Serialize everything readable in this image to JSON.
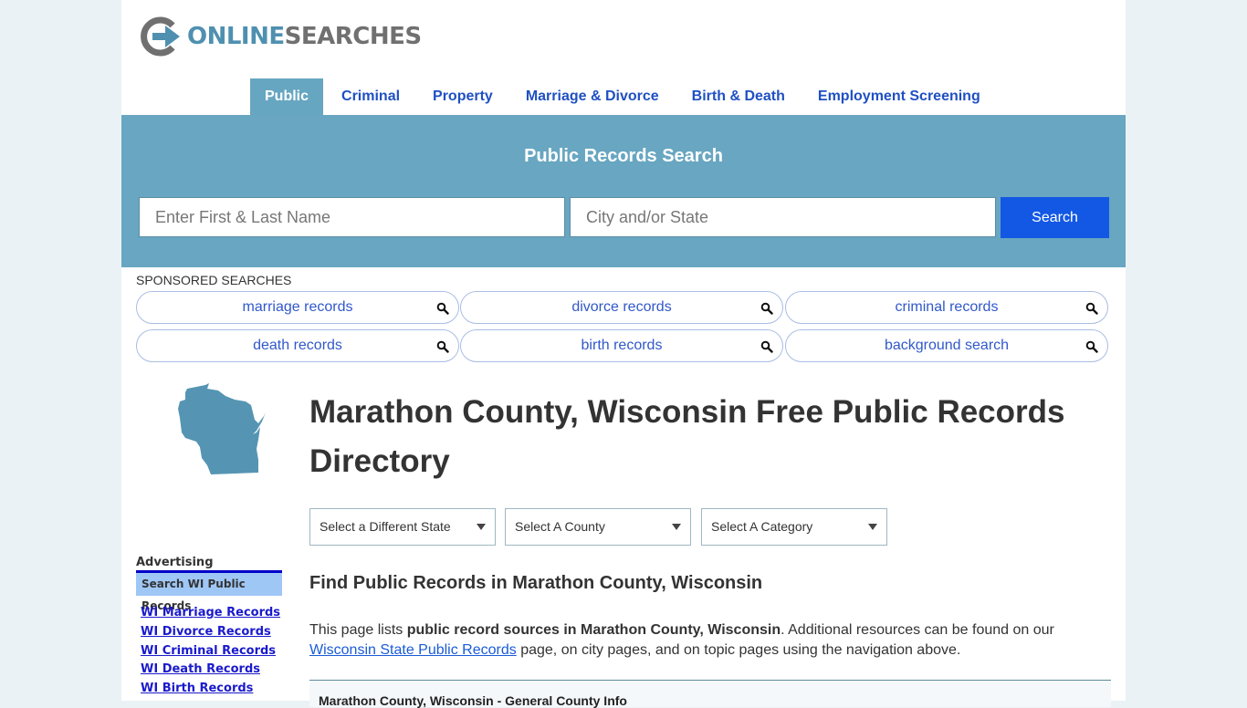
{
  "brand": {
    "part1": "ONLINE",
    "part2": "SEARCHES",
    "accent_color": "#4f90b0",
    "gray_color": "#707070"
  },
  "nav": {
    "items": [
      {
        "label": "Public",
        "active": true
      },
      {
        "label": "Criminal",
        "active": false
      },
      {
        "label": "Property",
        "active": false
      },
      {
        "label": "Marriage & Divorce",
        "active": false
      },
      {
        "label": "Birth & Death",
        "active": false
      },
      {
        "label": "Employment Screening",
        "active": false
      }
    ]
  },
  "hero": {
    "title": "Public Records Search",
    "name_placeholder": "Enter First & Last Name",
    "city_placeholder": "City and/or State",
    "search_label": "Search",
    "bg_color": "#68a6c1",
    "button_color": "#1358e4"
  },
  "sponsored": {
    "label": "SPONSORED SEARCHES",
    "items": [
      {
        "label": "marriage records",
        "icon": "search-icon"
      },
      {
        "label": "divorce records",
        "icon": "search-icon"
      },
      {
        "label": "criminal records",
        "icon": "search-icon"
      },
      {
        "label": "death records",
        "icon": "search-icon"
      },
      {
        "label": "birth records",
        "icon": "search-icon"
      },
      {
        "label": "background search",
        "icon": "search-icon"
      }
    ]
  },
  "main": {
    "title": "Marathon County, Wisconsin Free Public Records Directory",
    "selects": [
      {
        "selected": "Select a Different State"
      },
      {
        "selected": "Select A County"
      },
      {
        "selected": "Select A Category"
      }
    ],
    "section_heading": "Find Public Records in Marathon County, Wisconsin",
    "intro": {
      "pre": "This page lists ",
      "bold": "public record sources in Marathon County, Wisconsin",
      "mid": ". Additional resources can be found on our ",
      "link": "Wisconsin State Public Records",
      "post": " page, on city pages, and on topic pages using the navigation above."
    },
    "info_box_title": "Marathon County, Wisconsin - General County Info"
  },
  "sidebar": {
    "state_icon": "wisconsin-map-icon",
    "advertising_label": "Advertising",
    "ad_heading": "Search WI Public Records",
    "ad_links": [
      "WI Marriage Records",
      "WI Divorce Records",
      "WI Criminal Records",
      "WI Death Records",
      "WI Birth Records"
    ]
  }
}
